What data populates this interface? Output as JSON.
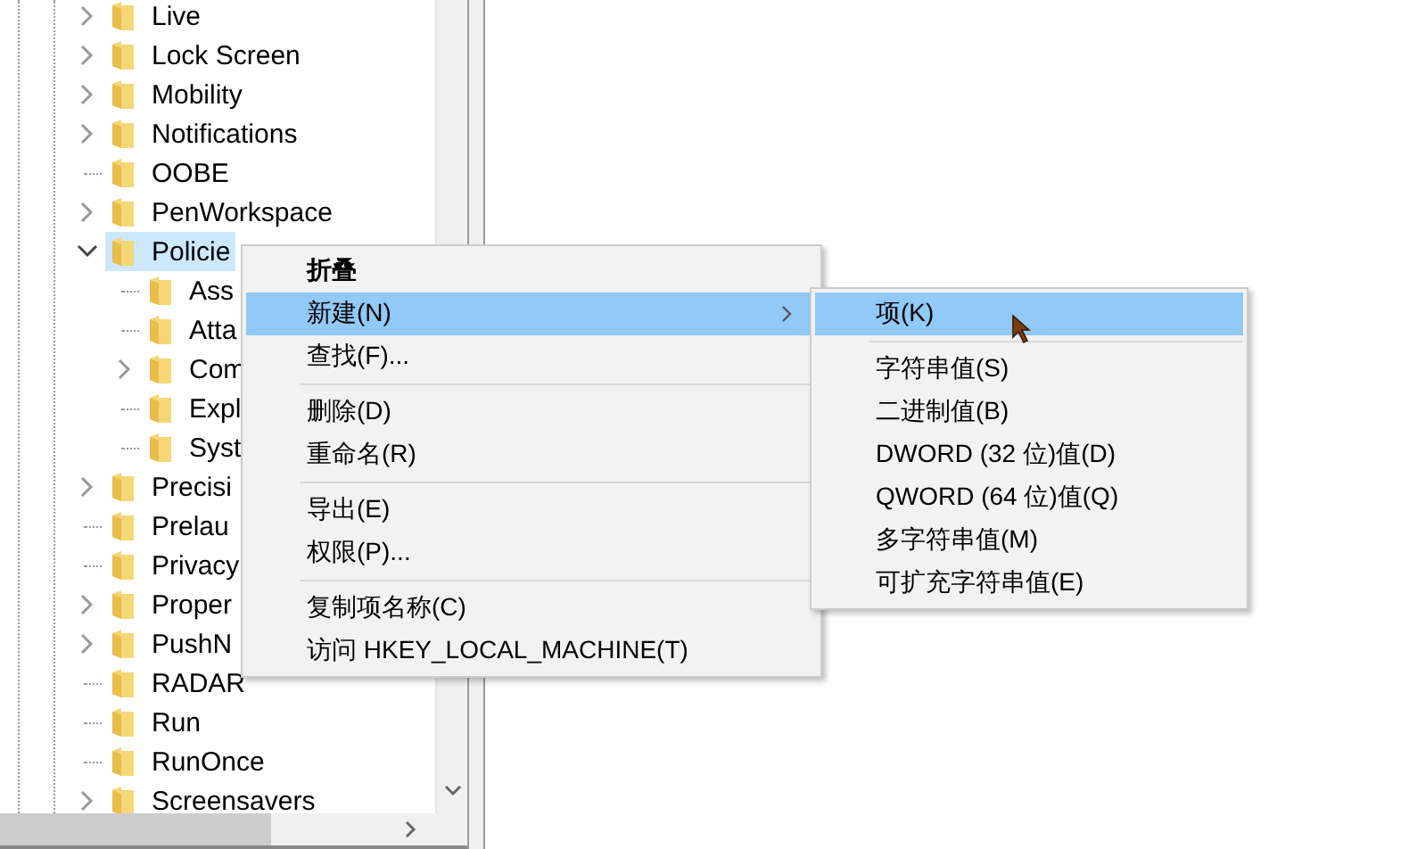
{
  "tree": {
    "items": [
      {
        "label": "Live",
        "kind": "branch",
        "expanded": false,
        "selected": false
      },
      {
        "label": "Lock Screen",
        "kind": "branch",
        "expanded": false,
        "selected": false
      },
      {
        "label": "Mobility",
        "kind": "branch",
        "expanded": false,
        "selected": false
      },
      {
        "label": "Notifications",
        "kind": "branch",
        "expanded": false,
        "selected": false
      },
      {
        "label": "OOBE",
        "kind": "leaf",
        "selected": false
      },
      {
        "label": "PenWorkspace",
        "kind": "branch",
        "expanded": false,
        "selected": false
      },
      {
        "label": "Policie",
        "kind": "branch",
        "expanded": true,
        "selected": true,
        "children": [
          {
            "label": "Ass",
            "kind": "leaf",
            "selected": false
          },
          {
            "label": "Atta",
            "kind": "leaf",
            "selected": false
          },
          {
            "label": "Com",
            "kind": "branch",
            "expanded": false,
            "selected": false
          },
          {
            "label": "Expl",
            "kind": "leaf",
            "selected": false
          },
          {
            "label": "Syst",
            "kind": "leaf",
            "selected": false
          }
        ]
      },
      {
        "label": "Precisi",
        "kind": "branch",
        "expanded": false,
        "selected": false
      },
      {
        "label": "Prelau",
        "kind": "leaf",
        "selected": false
      },
      {
        "label": "Privacy",
        "kind": "leaf",
        "selected": false
      },
      {
        "label": "Proper",
        "kind": "branch",
        "expanded": false,
        "selected": false
      },
      {
        "label": "PushN",
        "kind": "branch",
        "expanded": false,
        "selected": false
      },
      {
        "label": "RADAR",
        "kind": "leaf",
        "selected": false
      },
      {
        "label": "Run",
        "kind": "leaf",
        "selected": false
      },
      {
        "label": "RunOnce",
        "kind": "leaf",
        "selected": false
      },
      {
        "label": "Screensavers",
        "kind": "branch",
        "expanded": false,
        "selected": false
      }
    ]
  },
  "context_menu": {
    "items": [
      {
        "kind": "item",
        "label": "折叠",
        "default": true,
        "has_submenu": false,
        "selected": false
      },
      {
        "kind": "item",
        "label": "新建(N)",
        "default": false,
        "has_submenu": true,
        "selected": true
      },
      {
        "kind": "item",
        "label": "查找(F)...",
        "default": false,
        "has_submenu": false,
        "selected": false
      },
      {
        "kind": "separator"
      },
      {
        "kind": "item",
        "label": "删除(D)",
        "default": false,
        "has_submenu": false,
        "selected": false
      },
      {
        "kind": "item",
        "label": "重命名(R)",
        "default": false,
        "has_submenu": false,
        "selected": false
      },
      {
        "kind": "separator"
      },
      {
        "kind": "item",
        "label": "导出(E)",
        "default": false,
        "has_submenu": false,
        "selected": false
      },
      {
        "kind": "item",
        "label": "权限(P)...",
        "default": false,
        "has_submenu": false,
        "selected": false
      },
      {
        "kind": "separator"
      },
      {
        "kind": "item",
        "label": "复制项名称(C)",
        "default": false,
        "has_submenu": false,
        "selected": false
      },
      {
        "kind": "item",
        "label": "访问 HKEY_LOCAL_MACHINE(T)",
        "default": false,
        "has_submenu": false,
        "selected": false
      }
    ]
  },
  "submenu": {
    "items": [
      {
        "kind": "item",
        "label": "项(K)",
        "selected": true
      },
      {
        "kind": "separator"
      },
      {
        "kind": "item",
        "label": "字符串值(S)",
        "selected": false
      },
      {
        "kind": "item",
        "label": "二进制值(B)",
        "selected": false
      },
      {
        "kind": "item",
        "label": "DWORD (32 位)值(D)",
        "selected": false
      },
      {
        "kind": "item",
        "label": "QWORD (64 位)值(Q)",
        "selected": false
      },
      {
        "kind": "item",
        "label": "多字符串值(M)",
        "selected": false
      },
      {
        "kind": "item",
        "label": "可扩充字符串值(E)",
        "selected": false
      }
    ]
  }
}
